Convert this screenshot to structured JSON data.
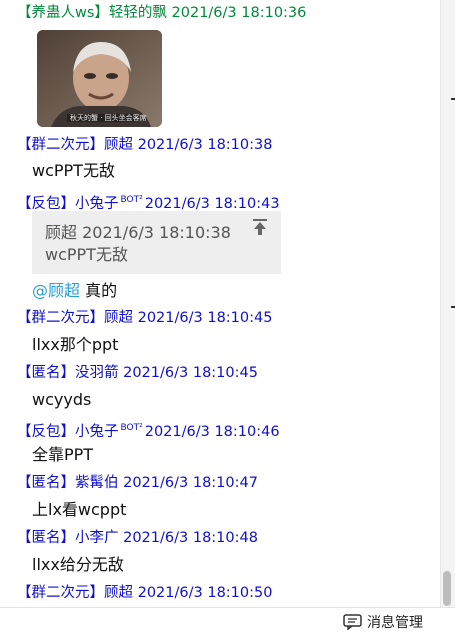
{
  "messages": [
    {
      "header": "【养蛊人ws】轻轻的飘 2021/6/3 18:10:36",
      "image_caption": "秋天的蟹 · 回头坐会客席"
    },
    {
      "header": "【群二次元】顾超 2021/6/3 18:10:38",
      "text": "wcPPT无敌"
    },
    {
      "header_pre": "【反包】小兔子",
      "bot": "BOT²",
      "header_post": "2021/6/3 18:10:43",
      "quote": {
        "meta": "顾超  2021/6/3 18:10:38",
        "text": "wcPPT无敌"
      },
      "mention": "@顾超",
      "text": "真的"
    },
    {
      "header": "【群二次元】顾超 2021/6/3 18:10:45",
      "text": "llxx那个ppt"
    },
    {
      "header": "【匿名】没羽箭 2021/6/3 18:10:45",
      "text": "wcyyds"
    },
    {
      "header_pre": "【反包】小兔子",
      "bot": "BOT²",
      "header_post": "2021/6/3 18:10:46",
      "text": "全靠PPT"
    },
    {
      "header": "【匿名】紫髯伯 2021/6/3 18:10:47",
      "text": "上lx看wcppt"
    },
    {
      "header": "【匿名】小李广 2021/6/3 18:10:48",
      "text": "llxx给分无敌"
    },
    {
      "header": "【群二次元】顾超 2021/6/3 18:10:50"
    }
  ],
  "bottom_bar": {
    "manage_label": "消息管理",
    "manage_icon": "chat-manage-icon"
  },
  "colors": {
    "header_blue": "#1010cc",
    "header_green": "#008a3a",
    "mention": "#2a9fd6",
    "quote_bg": "#eeeeee"
  }
}
